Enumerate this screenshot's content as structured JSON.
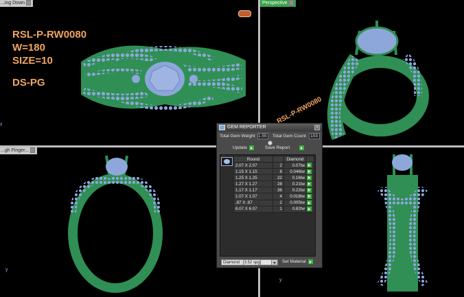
{
  "viewports": {
    "top_left_label": "...ing Down",
    "top_right_label": "Perspective",
    "bottom_left_label": "...gh Finger..."
  },
  "design_spec": {
    "sku": "RSL-P-RW0080",
    "weight": "W=180",
    "size": "SIZE=10",
    "type": "DS-PG",
    "diagonal_sku": "RSL-P-RW0080"
  },
  "axis_labels": {
    "y": "y",
    "z": "z"
  },
  "gem_reporter": {
    "title": "GEM REPORTER",
    "total_weight_label": "Total Gem Weight",
    "total_weight": "1.55",
    "total_count_label": "Total Gem Count",
    "total_count": "103",
    "update_label": "Update",
    "save_report_label": "Save Report",
    "columns": [
      "Round",
      "",
      "Diamond"
    ],
    "rows": [
      {
        "size": "2.07 X 2.07",
        "count": "2",
        "weight": "0.07tw"
      },
      {
        "size": "1.15 X 1.15",
        "count": "8",
        "weight": "0.046tw"
      },
      {
        "size": "1.25 X 1.25",
        "count": "22",
        "weight": "0.16tw"
      },
      {
        "size": "1.27 X 1.27",
        "count": "28",
        "weight": "0.21tw"
      },
      {
        "size": "1.17 X 1.17",
        "count": "36",
        "weight": "0.22tw"
      },
      {
        "size": "1.07 X 1.07",
        "count": "4",
        "weight": "0.018tw"
      },
      {
        "size": ".87 X .87",
        "count": "2",
        "weight": "0.005tw"
      },
      {
        "size": "6.07 X 6.07",
        "count": "1",
        "weight": "0.82tw"
      }
    ],
    "material_select": "Diamond : [3.52 spg]",
    "set_material_label": "Set Material"
  },
  "colors": {
    "ring_metal": "#2f8f55",
    "gem": "#8ea7da",
    "spec_text": "#f0a460",
    "go_button": "#3fb040"
  }
}
